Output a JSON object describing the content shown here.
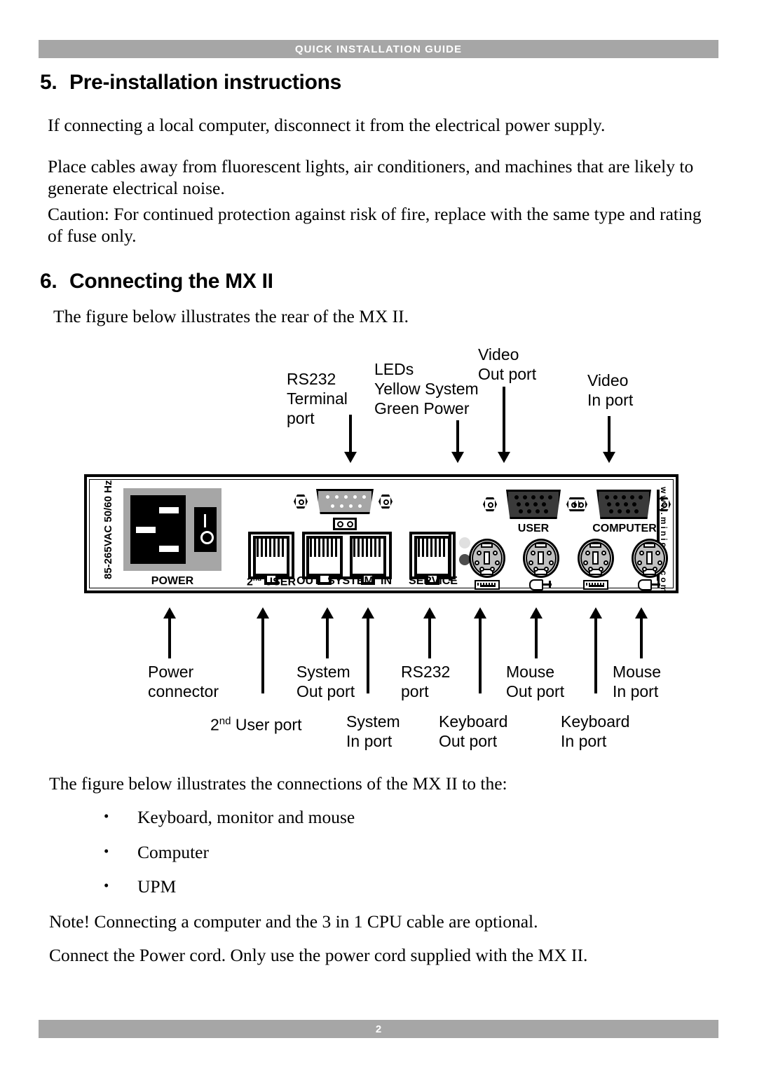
{
  "header": {
    "title": "QUICK INSTALLATION GUIDE"
  },
  "footer": {
    "page_number": "2"
  },
  "sections": [
    {
      "number": "5.",
      "title": "Pre-installation instructions",
      "paragraphs": [
        "If connecting a local computer, disconnect it from the electrical power supply.",
        "Place cables away from fluorescent lights, air conditioners, and machines that are likely to generate electrical noise.",
        "Caution: For continued protection against risk of fire, replace with the same type and rating of fuse only."
      ]
    },
    {
      "number": "6.",
      "title": "Connecting the MX II",
      "intro": "The figure below illustrates the rear of the MX II.",
      "after_figure": "The figure below illustrates the connections of the MX II to the:",
      "bullets": [
        "Keyboard, monitor and mouse",
        "Computer",
        "UPM"
      ],
      "notes": [
        "Note! Connecting a computer and the 3 in 1 CPU cable are optional.",
        "Connect the Power cord. Only use the power cord supplied with the MX II."
      ]
    }
  ],
  "figure": {
    "top_callouts": [
      {
        "lines": [
          "RS232",
          "Terminal",
          "port"
        ]
      },
      {
        "lines": [
          "LEDs",
          "Yellow System",
          "Green Power"
        ]
      },
      {
        "lines": [
          "Video",
          "Out port"
        ]
      },
      {
        "lines": [
          "Video",
          "In port"
        ]
      }
    ],
    "bottom_callouts": [
      {
        "lines": [
          "Power",
          "connector"
        ]
      },
      {
        "lines": [
          "2nd User port"
        ],
        "sup": "nd"
      },
      {
        "lines": [
          "System",
          "Out port"
        ]
      },
      {
        "lines": [
          "System",
          "In port"
        ]
      },
      {
        "lines": [
          "RS232",
          "port"
        ]
      },
      {
        "lines": [
          "Keyboard",
          "Out port"
        ]
      },
      {
        "lines": [
          "Mouse",
          "Out port"
        ]
      },
      {
        "lines": [
          "Keyboard",
          "In port"
        ]
      },
      {
        "lines": [
          "Mouse",
          "In port"
        ]
      }
    ],
    "panel": {
      "voltage_rating": "85-265VAC 50/60 Hz",
      "website": "www.minicom.com",
      "port_labels": {
        "power": "POWER",
        "second_user_prefix": "2",
        "second_user_sup": "nd",
        "second_user_suffix": " USER",
        "out": "OUT",
        "system": "SYSTEM",
        "in": "IN",
        "service": "SERVICE",
        "user": "USER",
        "computer": "COMPUTER"
      },
      "colors": {
        "panel_bg": "#ffffff",
        "power_block": "#a6a6a6",
        "connector_gray": "#c0c0c0",
        "vga_dark": "#3a3a3a",
        "led_yellow": "#e0e0e0",
        "led_green": "#4d4d4d",
        "bar_gray": "#a6a6a6"
      }
    }
  }
}
